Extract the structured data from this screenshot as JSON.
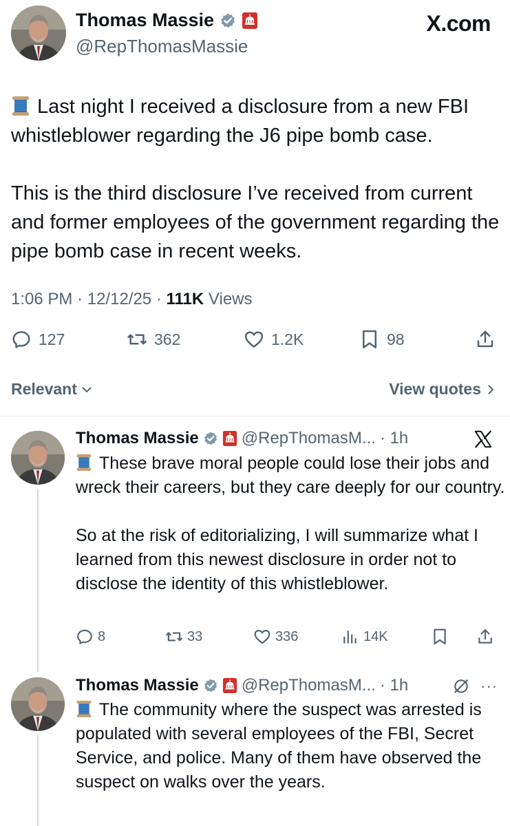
{
  "header": {
    "brand": "X.com"
  },
  "main_tweet": {
    "author_name": "Thomas Massie",
    "author_handle": "@RepThomasMassie",
    "paragraphs": [
      "Last night I received a disclosure from a new FBI whistleblower regarding the J6 pipe bomb case.",
      "This is the third disclosure I’ve received from current and former employees of the government regarding the pipe bomb case in recent weeks."
    ],
    "time": "1:06 PM",
    "date": "12/12/25",
    "views_count": "111K",
    "views_label": "Views",
    "replies": "127",
    "reposts": "362",
    "likes": "1.2K",
    "bookmarks": "98"
  },
  "sort": {
    "label": "Relevant",
    "view_quotes": "View quotes"
  },
  "replies": [
    {
      "author_name": "Thomas Massie",
      "author_handle": "@RepThomasM...",
      "age": "· 1h",
      "paragraphs": [
        "These brave moral people could lose their jobs and wreck their careers, but they care deeply for our country.",
        "So at the risk of editorializing, I will summarize what I learned from this newest disclosure in order not to disclose the identity of this whistleblower."
      ],
      "replies": "8",
      "reposts": "33",
      "likes": "336",
      "views": "14K"
    },
    {
      "author_name": "Thomas Massie",
      "author_handle": "@RepThomasM...",
      "age": "· 1h",
      "more": "···",
      "paragraphs": [
        "The community where the suspect was arrested is populated with several employees of the FBI, Secret Service, and police. Many of them have observed the suspect on walks over the years."
      ]
    }
  ],
  "colors": {
    "text": "#0f1419",
    "secondary": "#536471",
    "verified_badge": "#829aab",
    "affiliate_flag": "#d0312d",
    "divider": "#e7e9ea"
  },
  "icons": [
    "verified-icon",
    "gop-flag-icon",
    "spool-emoji-icon",
    "reply-icon",
    "repost-icon",
    "like-icon",
    "bookmark-icon",
    "share-icon",
    "views-icon",
    "x-logo-icon",
    "grok-icon",
    "chevron-down-icon",
    "chevron-right-icon"
  ]
}
